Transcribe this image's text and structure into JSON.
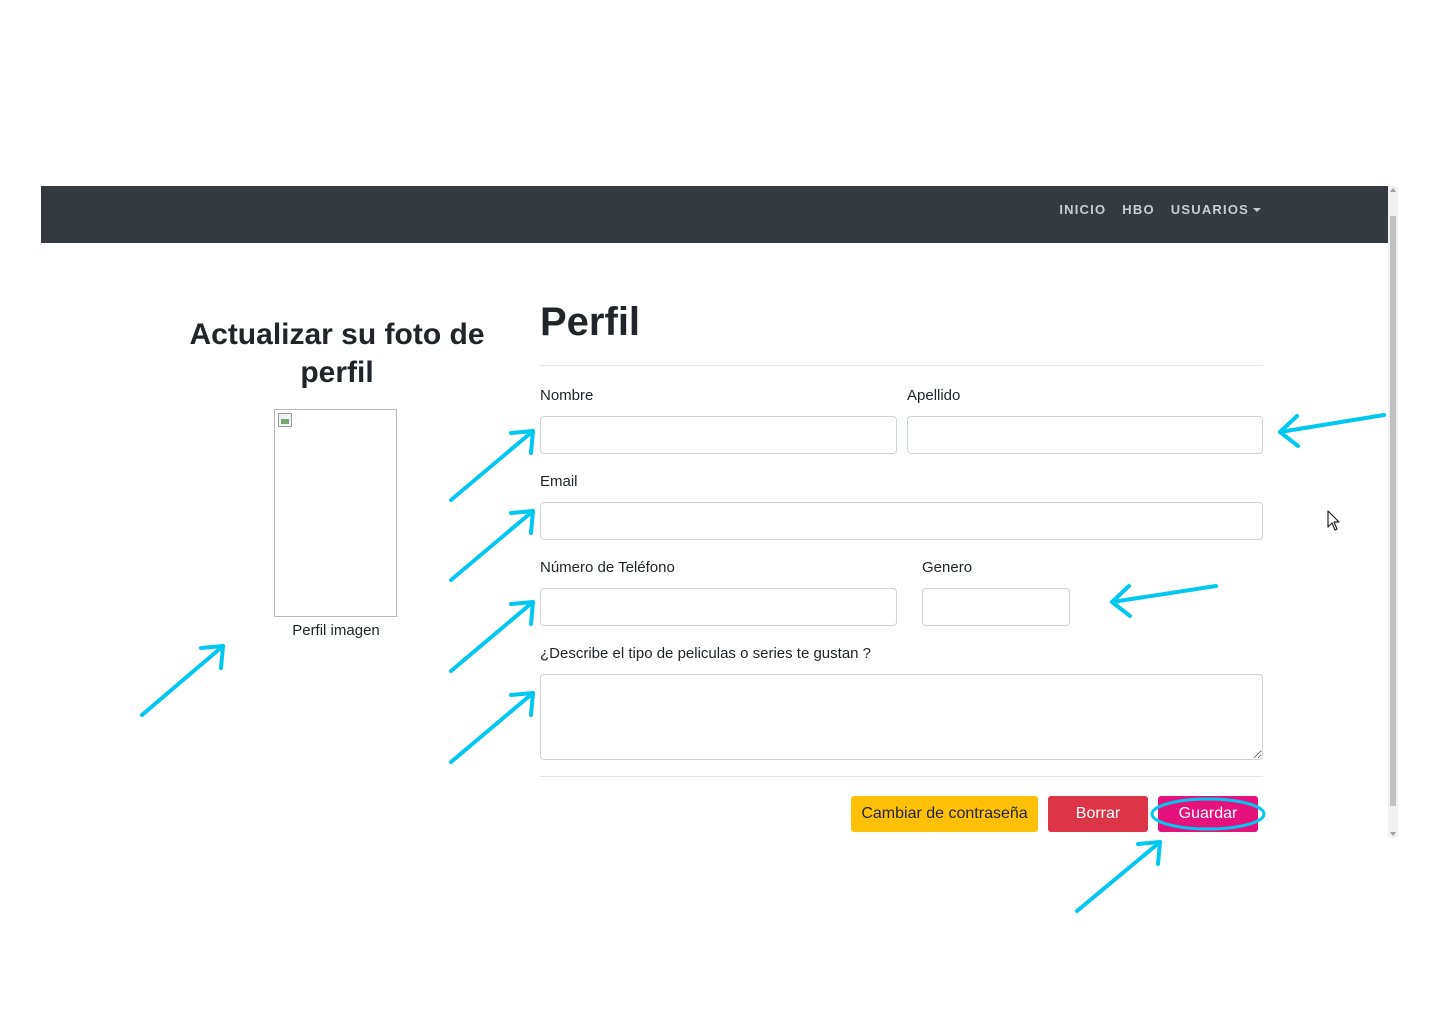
{
  "navbar": {
    "links": [
      {
        "label": "INICIO"
      },
      {
        "label": "HBO"
      },
      {
        "label": "USUARIOS"
      }
    ]
  },
  "photo": {
    "title": "Actualizar su foto de perfil",
    "caption": "Perfil imagen"
  },
  "form": {
    "title": "Perfil",
    "nombre": {
      "label": "Nombre",
      "value": ""
    },
    "apellido": {
      "label": "Apellido",
      "value": ""
    },
    "email": {
      "label": "Email",
      "value": ""
    },
    "telefono": {
      "label": "Número de Teléfono",
      "value": ""
    },
    "genero": {
      "label": "Genero",
      "value": ""
    },
    "descripcion": {
      "label": "¿Describe el tipo de peliculas o series te gustan ?",
      "value": ""
    }
  },
  "actions": {
    "change_password": "Cambiar de contraseña",
    "delete": "Borrar",
    "save": "Guardar"
  },
  "colors": {
    "navbar": "#343a40",
    "warning": "#ffc107",
    "danger": "#dc3545",
    "save": "#e5127d",
    "annotation": "#00c8f0"
  },
  "icons": [
    "dropdown-caret-icon",
    "broken-image-icon",
    "mouse-pointer-icon"
  ]
}
